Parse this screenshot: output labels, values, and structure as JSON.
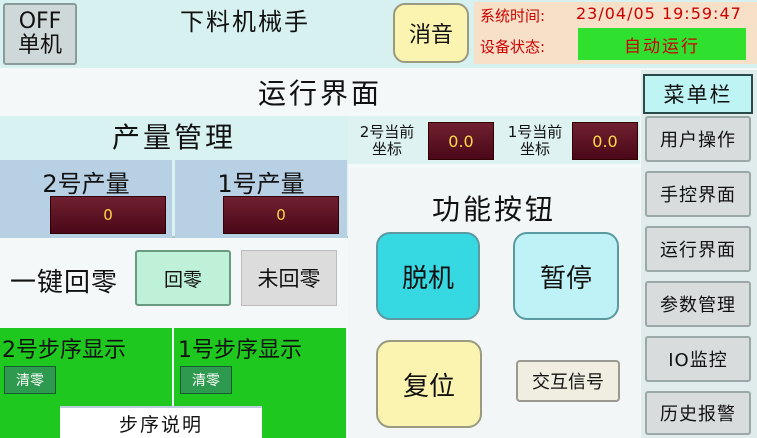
{
  "header": {
    "offline_label_line1": "OFF",
    "offline_label_line2": "单机",
    "title": "下料机械手",
    "mute_label": "消音",
    "system_time_label": "系统时间:",
    "system_time_value": "23/04/05  19:59:47",
    "device_state_label": "设备状态:",
    "device_state_value": "自动运行"
  },
  "page": {
    "title": "运行界面"
  },
  "production": {
    "title": "产量管理",
    "no2_label": "2号产量",
    "no2_value": "0",
    "no1_label": "1号产量",
    "no1_value": "0"
  },
  "zeroing": {
    "label": "一键回零",
    "zero_button": "回零",
    "status": "未回零"
  },
  "coordinates": {
    "no2_line1": "2号当前",
    "no2_line2": "坐标",
    "no2_value": "0.0",
    "no1_line1": "1号当前",
    "no1_line2": "坐标",
    "no1_value": "0.0"
  },
  "functions": {
    "title": "功能按钮",
    "offline": "脱机",
    "pause": "暂停",
    "reset": "复位",
    "interlock": "交互信号"
  },
  "steps": {
    "no2_title": "2号步序显示",
    "no2_clear": "清零",
    "no1_title": "1号步序显示",
    "no1_clear": "清零",
    "description": "步序说明"
  },
  "menu": {
    "title": "菜单栏",
    "items": [
      "用户操作",
      "手控界面",
      "运行界面",
      "参数管理",
      "IO监控",
      "历史报警"
    ]
  },
  "colors": {
    "header_band": "#d7f0f0",
    "state_indicator": "#2fe02f",
    "offline_button": "#36d8e2",
    "step_panel": "#1ec81e"
  }
}
